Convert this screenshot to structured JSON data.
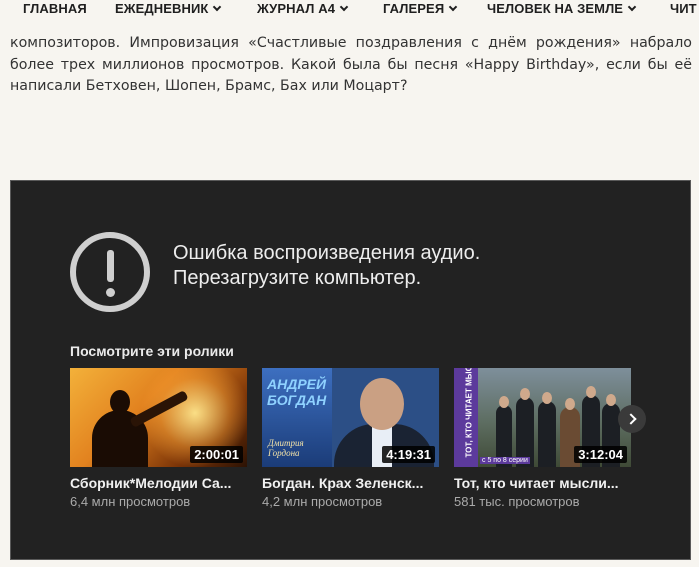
{
  "nav": {
    "items": [
      {
        "label": "ГЛАВНАЯ",
        "dropdown": false
      },
      {
        "label": "ЕЖЕДНЕВНИК",
        "dropdown": true
      },
      {
        "label": "ЖУРНАЛ А4",
        "dropdown": true
      },
      {
        "label": "ГАЛЕРЕЯ",
        "dropdown": true
      },
      {
        "label": "ЧЕЛОВЕК НА ЗЕМЛЕ",
        "dropdown": true
      },
      {
        "label": "ЧИТ",
        "dropdown": false
      }
    ]
  },
  "article": {
    "text": "композиторов. Импровизация «Счастливые поздравления с днём рождения» набрало более трех миллионов просмотров. Какой была бы песня «Happy Birthday», если бы её написали Бетховен, Шопен, Брамс, Бах или Моцарт?"
  },
  "player": {
    "error_line1": "Ошибка воспроизведения аудио.",
    "error_line2": "Перезагрузите компьютер.",
    "suggestions_title": "Посмотрите эти ролики",
    "videos": [
      {
        "title": "Сборник*Мелодии Са...",
        "views": "6,4 млн просмотров",
        "duration": "2:00:01"
      },
      {
        "title": "Богдан. Крах Зеленск...",
        "views": "4,2 млн просмотров",
        "duration": "4:19:31",
        "thumb_name": "АНДРЕЙ БОГДАН",
        "thumb_logo": "Дмитрия Гордона"
      },
      {
        "title": "Тот, кто читает мысли...",
        "views": "581 тыс. просмотров",
        "duration": "3:12:04",
        "thumb_band": "ТОТ, КТО ЧИТАЕТ МЫСЛИ (МЕНТАЛИСТ)",
        "thumb_series": "с 5 по 8 серии"
      }
    ]
  },
  "colors": {
    "page_bg": "#f7f5f0",
    "player_bg": "#222222",
    "icon_gray": "#cfcfcf"
  }
}
